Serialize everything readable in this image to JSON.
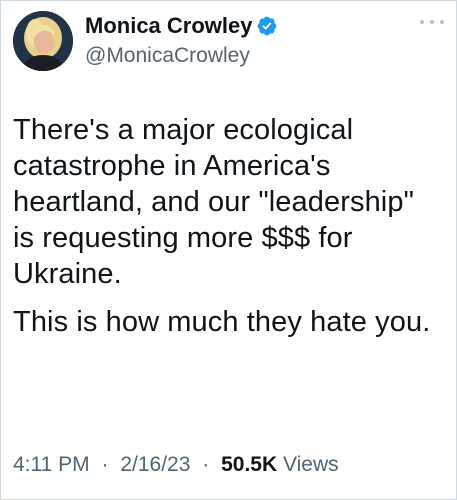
{
  "author": {
    "name": "Monica Crowley",
    "handle": "@MonicaCrowley",
    "verified": true,
    "verified_color": "#1d9bf0"
  },
  "tweet": {
    "paragraphs": [
      "There's a major ecological catastrophe in America's heartland, and our \"leadership\" is requesting more $$$ for Ukraine.",
      "This is how much they hate you."
    ]
  },
  "meta": {
    "time": "4:11 PM",
    "date": "2/16/23",
    "separator": "·",
    "views_count": "50.5K",
    "views_label": "Views"
  },
  "icons": {
    "more": "more-dots-icon",
    "verified": "verified-badge-icon"
  }
}
